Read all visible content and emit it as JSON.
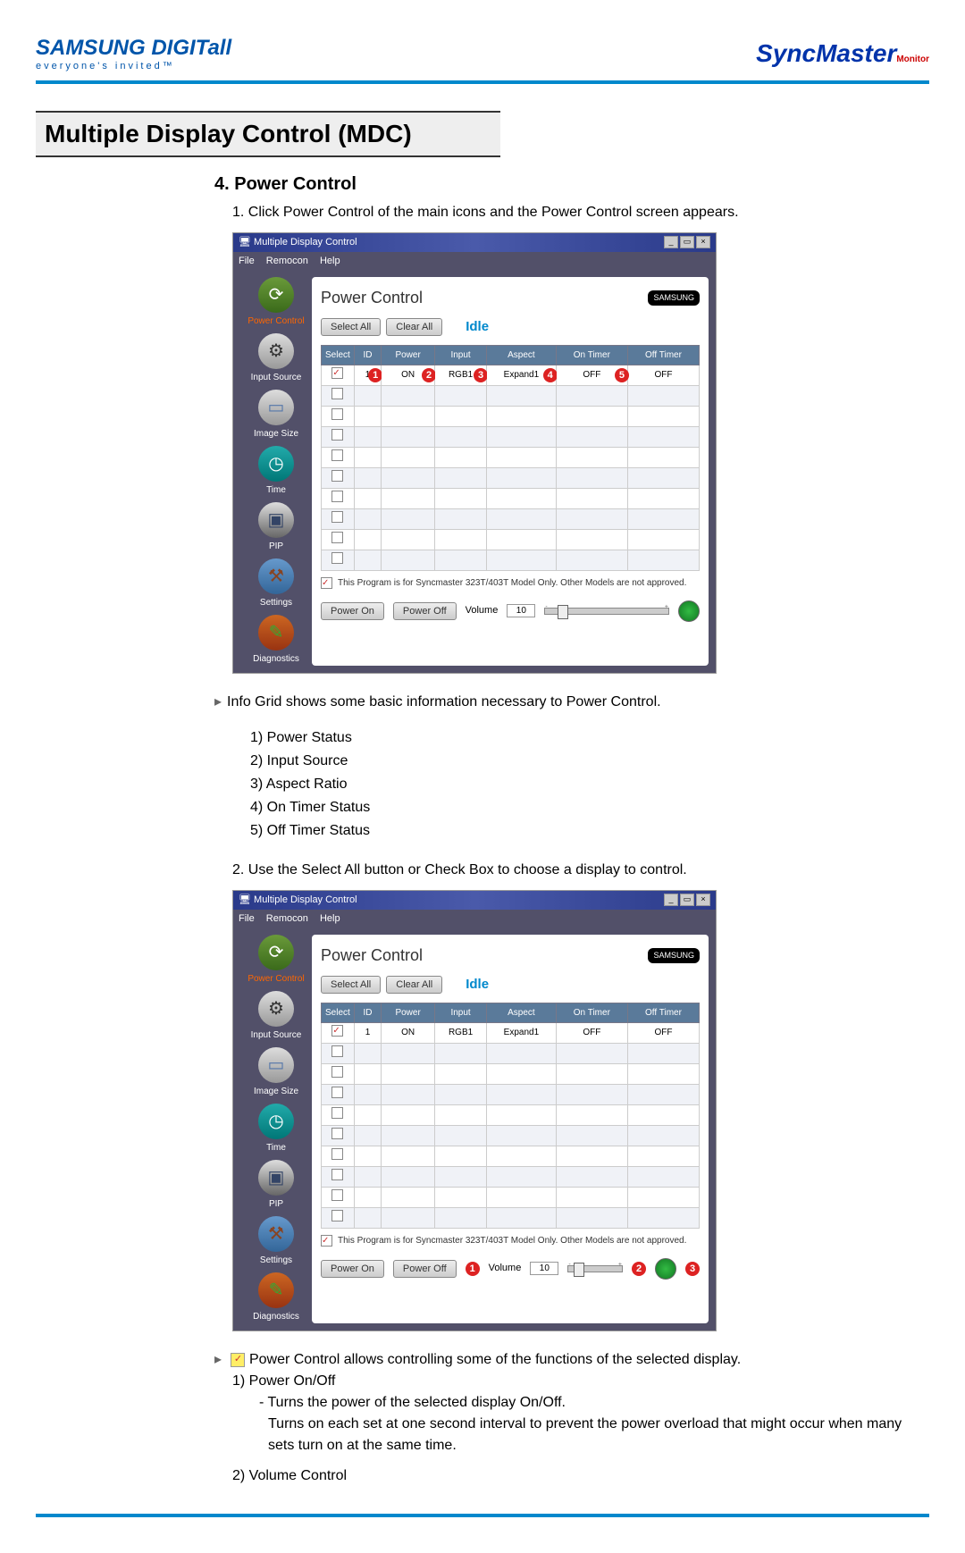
{
  "header": {
    "brandLeft": "SAMSUNG DIGITall",
    "tagline": "everyone's invited™",
    "brandRight": "SyncMaster",
    "brandRightSub": "Monitor"
  },
  "title": "Multiple Display Control (MDC)",
  "section": {
    "heading": "4. Power Control",
    "step1": "Click Power Control of the main icons and the Power Control screen appears.",
    "step2": "Use the Select All button or Check Box to choose a display to control."
  },
  "app": {
    "windowTitle": "Multiple Display Control",
    "menu": {
      "file": "File",
      "remocon": "Remocon",
      "help": "Help"
    },
    "sidebar": {
      "power": "Power Control",
      "input": "Input Source",
      "size": "Image Size",
      "time": "Time",
      "pip": "PIP",
      "settings": "Settings",
      "diag": "Diagnostics"
    },
    "panelTitle": "Power Control",
    "samsungLabel": "SAMSUNG",
    "selectAll": "Select All",
    "clearAll": "Clear All",
    "idle": "Idle",
    "columns": {
      "select": "Select",
      "id": "ID",
      "power": "Power",
      "input": "Input",
      "aspect": "Aspect",
      "onTimer": "On Timer",
      "offTimer": "Off Timer"
    },
    "row1": {
      "id": "1",
      "power": "ON",
      "input": "RGB1",
      "aspect": "Expand1",
      "onTimer": "OFF",
      "offTimer": "OFF"
    },
    "note": "This Program is for Syncmaster 323T/403T Model Only. Other Models are not approved.",
    "powerOn": "Power On",
    "powerOff": "Power Off",
    "volumeLabel": "Volume",
    "volumeValue": "10"
  },
  "badges": {
    "b1": "1",
    "b2": "2",
    "b3": "3",
    "b4": "4",
    "b5": "5"
  },
  "info1": {
    "intro": "Info Grid shows some basic information necessary to Power Control.",
    "i1": "1) Power Status",
    "i2": "2) Input Source",
    "i3": "3) Aspect Ratio",
    "i4": "4) On Timer Status",
    "i5": "5) Off Timer Status"
  },
  "info2": {
    "intro": "Power Control allows controlling some of the functions of the selected display.",
    "h1": "1)  Power On/Off",
    "d1a": "- Turns the power of the selected display On/Off.",
    "d1b": "Turns on each set at one second interval to prevent the power overload that might occur when many sets turn on at the same time.",
    "h2": "2)  Volume Control"
  }
}
